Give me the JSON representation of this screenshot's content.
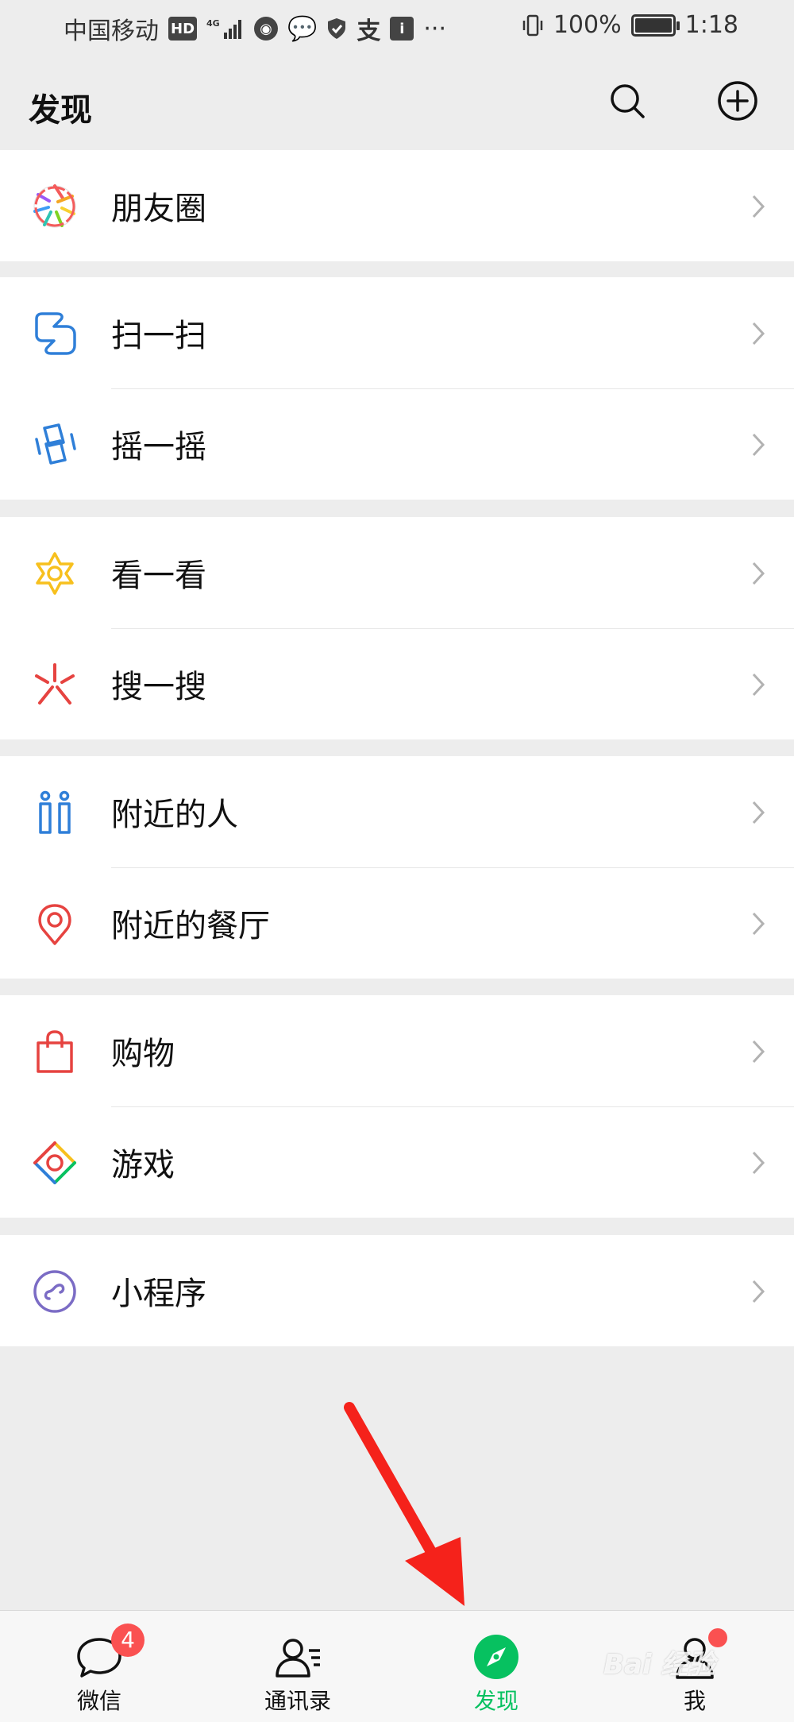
{
  "status_bar": {
    "carrier": "中国移动",
    "hd_badge": "HD",
    "network": "4G",
    "battery": "100%",
    "battery_level": 1.0,
    "time": "1:18",
    "overflow": "···"
  },
  "header": {
    "title": "发现",
    "search_icon": "search-icon",
    "add_icon": "plus-circle-icon"
  },
  "groups": [
    {
      "items": [
        {
          "label": "朋友圈",
          "icon": "moments-aperture-icon"
        }
      ]
    },
    {
      "items": [
        {
          "label": "扫一扫",
          "icon": "scan-icon"
        },
        {
          "label": "摇一摇",
          "icon": "shake-icon"
        }
      ]
    },
    {
      "items": [
        {
          "label": "看一看",
          "icon": "top-stories-icon"
        },
        {
          "label": "搜一搜",
          "icon": "search-spark-icon"
        }
      ]
    },
    {
      "items": [
        {
          "label": "附近的人",
          "icon": "people-nearby-icon"
        },
        {
          "label": "附近的餐厅",
          "icon": "location-pin-icon"
        }
      ]
    },
    {
      "items": [
        {
          "label": "购物",
          "icon": "shopping-bag-icon"
        },
        {
          "label": "游戏",
          "icon": "games-icon"
        }
      ]
    },
    {
      "items": [
        {
          "label": "小程序",
          "icon": "mini-programs-icon"
        }
      ]
    }
  ],
  "tabbar": {
    "tabs": [
      {
        "label": "微信",
        "icon": "chat-bubble-icon",
        "badge": "4",
        "active": false
      },
      {
        "label": "通讯录",
        "icon": "contacts-icon",
        "active": false
      },
      {
        "label": "发现",
        "icon": "compass-icon",
        "active": true
      },
      {
        "label": "我",
        "icon": "person-icon",
        "dot": true,
        "active": false
      }
    ]
  },
  "annotation": {
    "arrow_color": "#f5221b",
    "target_tab": "发现"
  },
  "watermark": "Bai 经验",
  "colors": {
    "accent": "#07c160",
    "badge": "#fa5151",
    "background": "#ededed"
  }
}
